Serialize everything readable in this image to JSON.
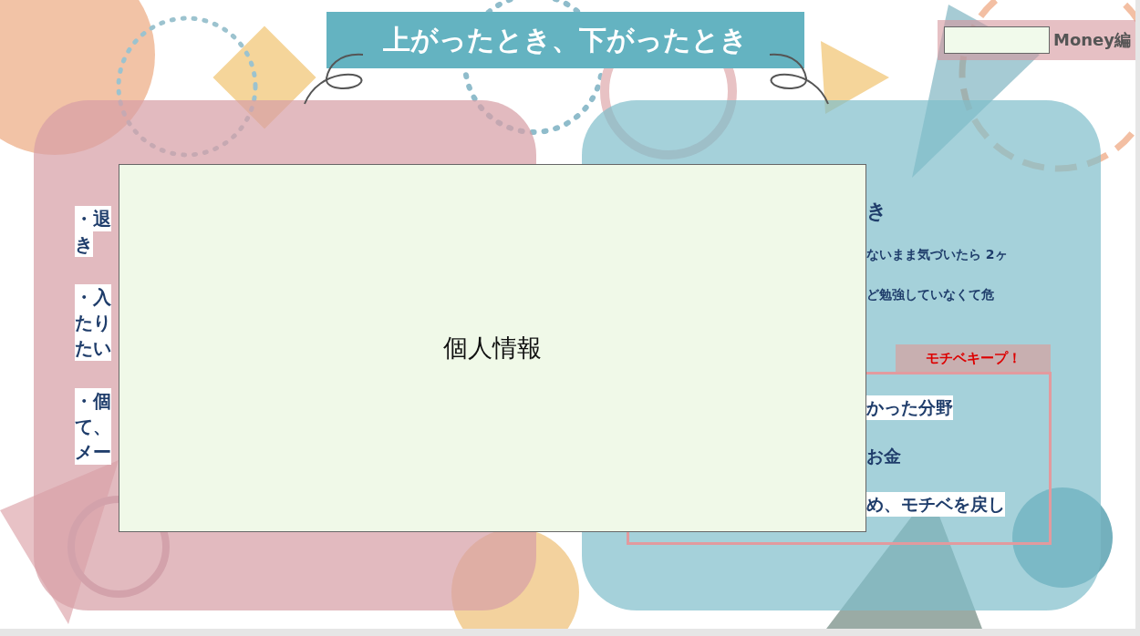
{
  "title": "上がったとき、下がったとき",
  "tag": {
    "label": "Money編"
  },
  "left_panel": {
    "items": [
      [
        "・退",
        "き"
      ],
      [
        "・入",
        "たり",
        "たい"
      ],
      [
        "・個",
        "て、",
        "メー"
      ]
    ]
  },
  "right_panel": {
    "heading": "き",
    "body": [
      "ないまま気づいたら 2ヶ",
      "ど勉強していなくて危"
    ],
    "note": {
      "label": "モチベキープ！",
      "lead": "かった分野",
      "item": "お金",
      "closing": "め、モチベを戻し"
    }
  },
  "overlay": {
    "label": "個人情報"
  }
}
